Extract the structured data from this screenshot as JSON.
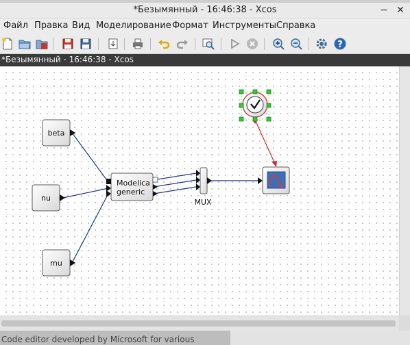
{
  "window": {
    "title": "*Безымянный - 16:46:38 - Xcos"
  },
  "window_controls": {
    "minimize": "−",
    "maximize": "□",
    "close": "✕"
  },
  "menu": [
    {
      "label": "Файл"
    },
    {
      "label": "Правка"
    },
    {
      "label": "Вид"
    },
    {
      "label": "Моделирование"
    },
    {
      "label": "Формат"
    },
    {
      "label": "Инструменты"
    },
    {
      "label": "Справка"
    }
  ],
  "toolbar": [
    {
      "icon": "new-diagram-icon"
    },
    {
      "icon": "open-icon"
    },
    {
      "icon": "open-in-scilab-icon"
    },
    {
      "icon": "save-icon"
    },
    {
      "icon": "save-as-icon"
    },
    {
      "icon": "export-icon"
    },
    {
      "icon": "print-icon"
    },
    {
      "icon": "undo-icon"
    },
    {
      "icon": "redo-icon"
    },
    {
      "icon": "fit-diagram-icon"
    },
    {
      "icon": "start-icon"
    },
    {
      "icon": "stop-icon"
    },
    {
      "icon": "zoom-in-icon"
    },
    {
      "icon": "zoom-out-icon"
    },
    {
      "icon": "setup-icon"
    },
    {
      "icon": "help-icon"
    }
  ],
  "tab": {
    "title": "*Безымянный - 16:46:38 - Xcos"
  },
  "diagram": {
    "blocks": {
      "beta": "beta",
      "nu": "nu",
      "mu": "mu",
      "modelica_line1": "Modelica",
      "modelica_line2": "generic",
      "mux_label": "MUX"
    }
  },
  "bottom": {
    "text": "Code editor developed by Microsoft for various"
  },
  "colors": {
    "link_blue": "#1f2f9c",
    "event_link_red": "#d9262b",
    "selection_green": "#2ecc2e",
    "tab_header": "#3a3a3a"
  }
}
